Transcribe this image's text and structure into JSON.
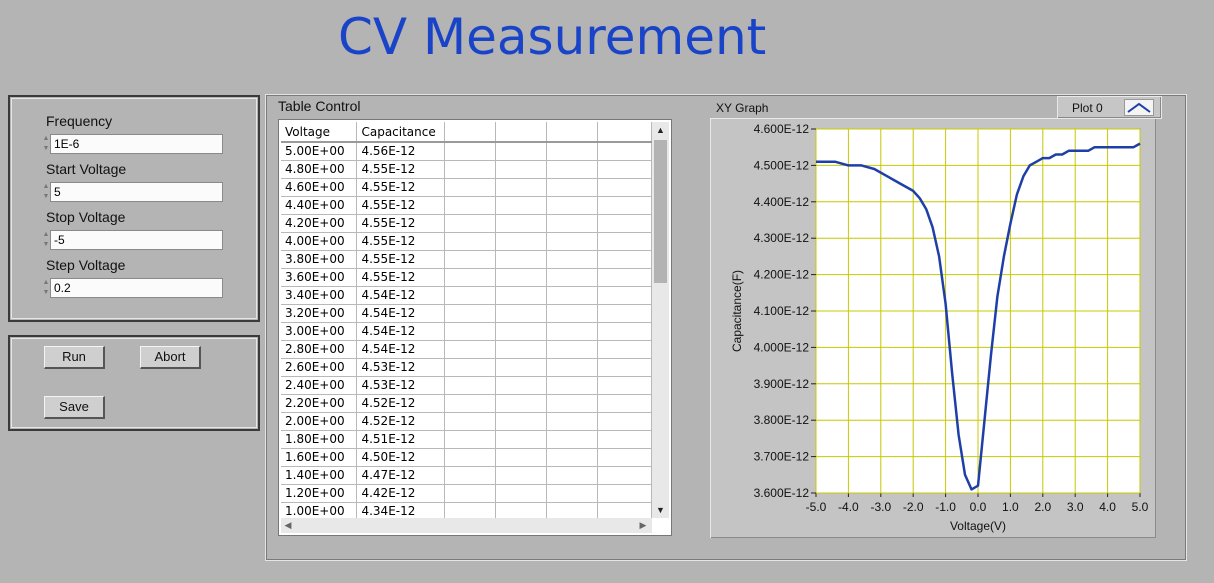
{
  "title": "CV Measurement",
  "controls": {
    "frequency": {
      "label": "Frequency",
      "value": "1E-6"
    },
    "start_voltage": {
      "label": "Start Voltage",
      "value": "5"
    },
    "stop_voltage": {
      "label": "Stop Voltage",
      "value": "-5"
    },
    "step_voltage": {
      "label": "Step Voltage",
      "value": "0.2"
    }
  },
  "buttons": {
    "run": "Run",
    "abort": "Abort",
    "save": "Save"
  },
  "table": {
    "label": "Table Control",
    "headers": [
      "Voltage",
      "Capacitance",
      "",
      "",
      "",
      ""
    ],
    "rows": [
      [
        "5.00E+00",
        "4.56E-12"
      ],
      [
        "4.80E+00",
        "4.55E-12"
      ],
      [
        "4.60E+00",
        "4.55E-12"
      ],
      [
        "4.40E+00",
        "4.55E-12"
      ],
      [
        "4.20E+00",
        "4.55E-12"
      ],
      [
        "4.00E+00",
        "4.55E-12"
      ],
      [
        "3.80E+00",
        "4.55E-12"
      ],
      [
        "3.60E+00",
        "4.55E-12"
      ],
      [
        "3.40E+00",
        "4.54E-12"
      ],
      [
        "3.20E+00",
        "4.54E-12"
      ],
      [
        "3.00E+00",
        "4.54E-12"
      ],
      [
        "2.80E+00",
        "4.54E-12"
      ],
      [
        "2.60E+00",
        "4.53E-12"
      ],
      [
        "2.40E+00",
        "4.53E-12"
      ],
      [
        "2.20E+00",
        "4.52E-12"
      ],
      [
        "2.00E+00",
        "4.52E-12"
      ],
      [
        "1.80E+00",
        "4.51E-12"
      ],
      [
        "1.60E+00",
        "4.50E-12"
      ],
      [
        "1.40E+00",
        "4.47E-12"
      ],
      [
        "1.20E+00",
        "4.42E-12"
      ],
      [
        "1.00E+00",
        "4.34E-12"
      ]
    ]
  },
  "graph": {
    "label": "XY Graph",
    "legend": "Plot 0"
  },
  "chart_data": {
    "type": "line",
    "title": "",
    "xlabel": "Voltage(V)",
    "ylabel": "Capacitance(F)",
    "xlim": [
      -5.0,
      5.0
    ],
    "ylim": [
      3.6e-12,
      4.6e-12
    ],
    "grid": true,
    "line_color": "#1f3fa8",
    "grid_color": "#c8c800",
    "x_ticks": [
      "-5.0",
      "-4.0",
      "-3.0",
      "-2.0",
      "-1.0",
      "0.0",
      "1.0",
      "2.0",
      "3.0",
      "4.0",
      "5.0"
    ],
    "y_ticks": [
      "4.600E-12",
      "4.500E-12",
      "4.400E-12",
      "4.300E-12",
      "4.200E-12",
      "4.100E-12",
      "4.000E-12",
      "3.900E-12",
      "3.800E-12",
      "3.700E-12",
      "3.600E-12"
    ],
    "series": [
      {
        "x": [
          -5.0,
          -4.4,
          -4.0,
          -3.6,
          -3.2,
          -2.8,
          -2.4,
          -2.0,
          -1.8,
          -1.6,
          -1.4,
          -1.2,
          -1.0,
          -0.8,
          -0.6,
          -0.4,
          -0.2,
          0.0,
          0.2,
          0.4,
          0.6,
          0.8,
          1.0,
          1.2,
          1.4,
          1.6,
          1.8,
          2.0,
          2.2,
          2.4,
          2.6,
          2.8,
          3.0,
          3.2,
          3.4,
          3.6,
          3.8,
          4.0,
          4.2,
          4.4,
          4.6,
          4.8,
          5.0
        ],
        "y": [
          4.51e-12,
          4.51e-12,
          4.5e-12,
          4.5e-12,
          4.49e-12,
          4.47e-12,
          4.45e-12,
          4.43e-12,
          4.41e-12,
          4.38e-12,
          4.33e-12,
          4.25e-12,
          4.12e-12,
          3.93e-12,
          3.76e-12,
          3.65e-12,
          3.61e-12,
          3.62e-12,
          3.8e-12,
          3.98e-12,
          4.14e-12,
          4.25e-12,
          4.34e-12,
          4.42e-12,
          4.47e-12,
          4.5e-12,
          4.51e-12,
          4.52e-12,
          4.52e-12,
          4.53e-12,
          4.53e-12,
          4.54e-12,
          4.54e-12,
          4.54e-12,
          4.54e-12,
          4.55e-12,
          4.55e-12,
          4.55e-12,
          4.55e-12,
          4.55e-12,
          4.55e-12,
          4.55e-12,
          4.56e-12
        ]
      }
    ]
  }
}
